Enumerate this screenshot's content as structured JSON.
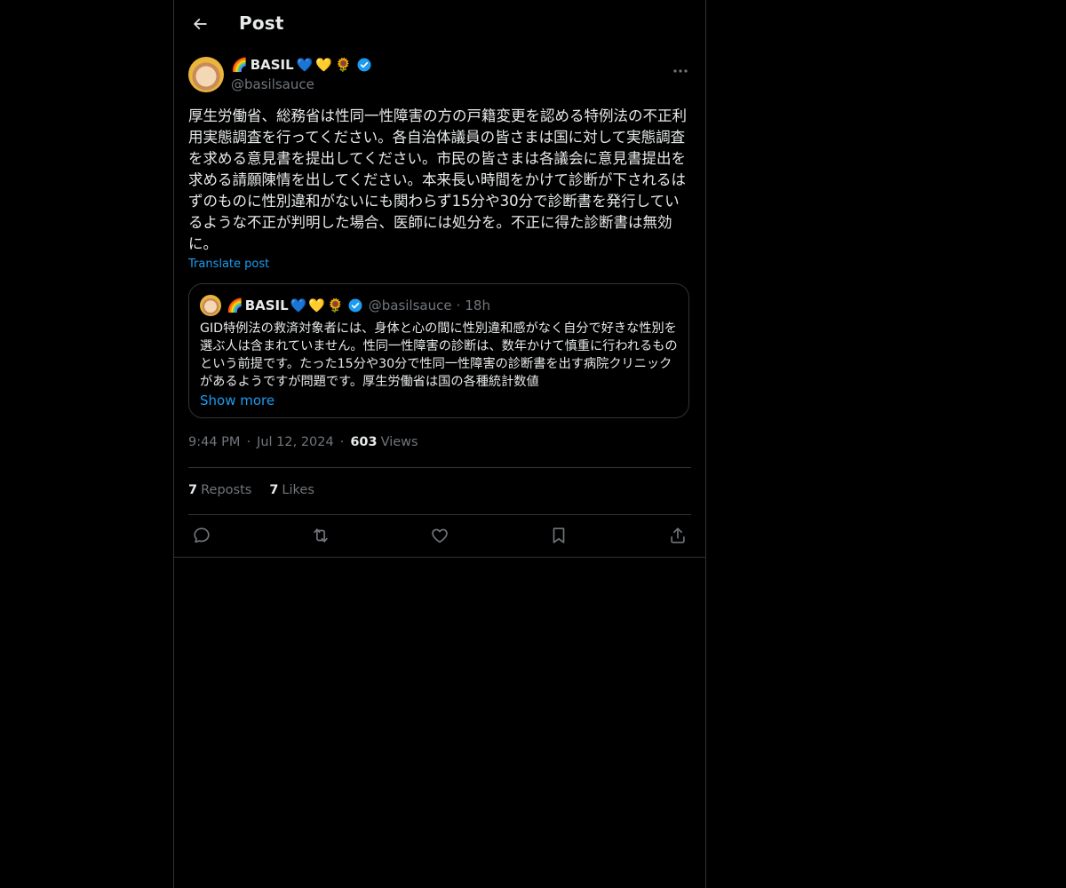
{
  "header": {
    "title": "Post",
    "back_icon": "arrow-left-icon"
  },
  "author": {
    "display_name": "BASIL",
    "name_emojis": [
      "🌈",
      "💙",
      "💛",
      "🌻"
    ],
    "handle": "@basilsauce",
    "verified": true
  },
  "post": {
    "text": "厚生労働省、総務省は性同一性障害の方の戸籍変更を認める特例法の不正利用実態調査を行ってください。各自治体議員の皆さまは国に対して実態調査を求める意見書を提出してください。市民の皆さまは各議会に意見書提出を求める請願陳情を出してください。本来長い時間をかけて診断が下されるはずのものに性別違和がないにも関わらず15分や30分で診断書を発行しているような不正が判明した場合、医師には処分を。不正に得た診断書は無効に。",
    "translate_label": "Translate post"
  },
  "quote": {
    "display_name": "BASIL",
    "name_emojis": [
      "🌈",
      "💙",
      "💛",
      "🌻"
    ],
    "handle": "@basilsauce",
    "separator": "·",
    "time": "18h",
    "text": "GID特例法の救済対象者には、身体と心の間に性別違和感がなく自分で好きな性別を選ぶ人は含まれていません。性同一性障害の診断は、数年かけて慎重に行われるものという前提です。たった15分や30分で性同一性障害の診断書を出す病院クリニックがあるようですが問題です。厚生労働省は国の各種統計数値",
    "show_more": "Show more"
  },
  "meta": {
    "time": "9:44 PM",
    "separator": "·",
    "date": "Jul 12, 2024",
    "views_count": "603",
    "views_label": "Views"
  },
  "stats": {
    "reposts_count": "7",
    "reposts_label": "Reposts",
    "likes_count": "7",
    "likes_label": "Likes"
  },
  "actions": [
    "reply-icon",
    "repost-icon",
    "like-icon",
    "bookmark-icon",
    "share-icon"
  ],
  "colors": {
    "background": "#000000",
    "text": "#e7e9ea",
    "muted": "#71767b",
    "accent": "#1d9bf0",
    "border": "#2f3336"
  }
}
